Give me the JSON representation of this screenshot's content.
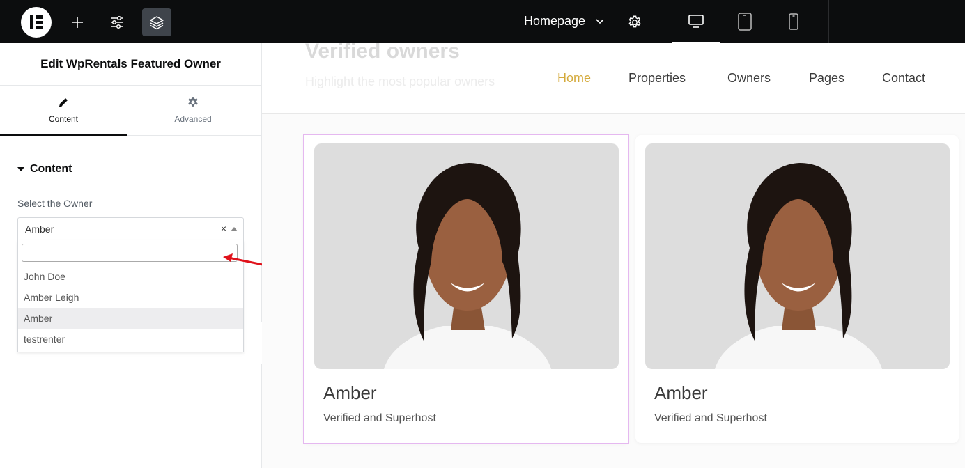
{
  "topbar": {
    "page_label": "Homepage"
  },
  "panel": {
    "title": "Edit WpRentals Featured Owner",
    "tabs": [
      {
        "label": "Content",
        "icon": "pencil-icon"
      },
      {
        "label": "Advanced",
        "icon": "gear-icon"
      }
    ],
    "section_title": "Content",
    "field_label": "Select the Owner",
    "select_value": "Amber",
    "clear_symbol": "×",
    "search_value": "",
    "options": [
      "John Doe",
      "Amber Leigh",
      "Amber",
      "testrenter"
    ],
    "selected_option": "Amber"
  },
  "site": {
    "ghost_title": "Verified owners",
    "ghost_subtitle": "Highlight the most popular owners",
    "nav": [
      "Home",
      "Properties",
      "Owners",
      "Pages",
      "Contact"
    ],
    "accent_color": "#d4aa3c"
  },
  "cards": [
    {
      "name": "Amber",
      "tagline": "Verified and Superhost"
    },
    {
      "name": "Amber",
      "tagline": "Verified and Superhost"
    }
  ],
  "annotation": {
    "arrow_color": "#e0121b"
  }
}
